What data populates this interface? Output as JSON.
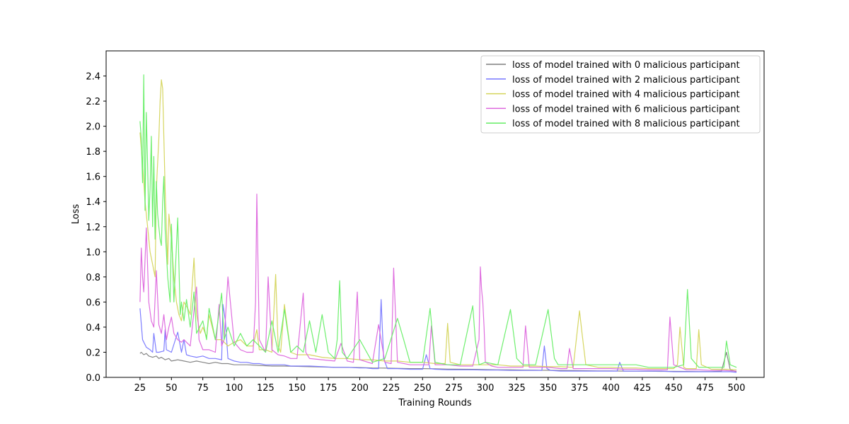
{
  "chart_data": {
    "type": "line",
    "title": "",
    "xlabel": "Training Rounds",
    "ylabel": "Loss",
    "xlim": [
      -2,
      522
    ],
    "ylim": [
      0,
      2.6
    ],
    "x_ticks": [
      25,
      50,
      75,
      100,
      125,
      150,
      175,
      200,
      225,
      250,
      275,
      300,
      325,
      350,
      375,
      400,
      425,
      450,
      475,
      500
    ],
    "y_ticks": [
      0.0,
      0.2,
      0.4,
      0.6,
      0.8,
      1.0,
      1.2,
      1.4,
      1.6,
      1.8,
      2.0,
      2.2,
      2.4
    ],
    "y_tick_labels": [
      "0.0",
      "0.2",
      "0.4",
      "0.6",
      "0.8",
      "1.0",
      "1.2",
      "1.4",
      "1.6",
      "1.8",
      "2.0",
      "2.2",
      "2.4"
    ],
    "grid": false,
    "legend_position": "top-right",
    "series": [
      {
        "name": "loss of model trained with 0 malicious participant",
        "color": "#7f7f7f",
        "x": [
          25,
          26,
          28,
          30,
          32,
          35,
          38,
          40,
          42,
          45,
          48,
          50,
          55,
          60,
          65,
          70,
          75,
          80,
          85,
          90,
          95,
          100,
          110,
          120,
          130,
          140,
          150,
          160,
          170,
          180,
          190,
          200,
          210,
          220,
          230,
          240,
          250,
          260,
          270,
          280,
          290,
          300,
          310,
          320,
          330,
          340,
          350,
          360,
          370,
          380,
          390,
          400,
          410,
          420,
          430,
          440,
          450,
          460,
          470,
          480,
          488,
          492,
          495,
          500
        ],
        "values": [
          0.19,
          0.2,
          0.18,
          0.19,
          0.17,
          0.16,
          0.17,
          0.15,
          0.16,
          0.14,
          0.15,
          0.13,
          0.14,
          0.13,
          0.12,
          0.13,
          0.12,
          0.11,
          0.12,
          0.11,
          0.11,
          0.1,
          0.1,
          0.095,
          0.09,
          0.09,
          0.088,
          0.085,
          0.083,
          0.08,
          0.08,
          0.078,
          0.075,
          0.074,
          0.072,
          0.07,
          0.07,
          0.068,
          0.066,
          0.065,
          0.064,
          0.062,
          0.06,
          0.06,
          0.058,
          0.057,
          0.056,
          0.055,
          0.054,
          0.053,
          0.052,
          0.052,
          0.05,
          0.05,
          0.049,
          0.048,
          0.048,
          0.047,
          0.046,
          0.046,
          0.05,
          0.2,
          0.06,
          0.045
        ]
      },
      {
        "name": "loss of model trained with 2 malicious participant",
        "color": "#7777ff",
        "x": [
          25,
          27,
          30,
          33,
          35,
          36,
          38,
          40,
          44,
          45,
          46,
          50,
          55,
          58,
          60,
          62,
          65,
          70,
          75,
          80,
          85,
          90,
          91,
          93,
          95,
          100,
          105,
          110,
          115,
          120,
          125,
          130,
          135,
          140,
          145,
          150,
          160,
          170,
          180,
          190,
          200,
          205,
          210,
          215,
          217,
          219,
          222,
          230,
          240,
          250,
          253,
          256,
          260,
          270,
          280,
          290,
          300,
          310,
          320,
          330,
          340,
          345,
          347,
          349,
          352,
          360,
          370,
          380,
          390,
          400,
          405,
          407,
          410,
          420,
          430,
          440,
          450,
          460,
          470,
          480,
          490,
          495,
          500
        ],
        "values": [
          0.55,
          0.3,
          0.24,
          0.22,
          0.2,
          0.35,
          0.2,
          0.2,
          0.21,
          0.38,
          0.22,
          0.2,
          0.36,
          0.2,
          0.3,
          0.18,
          0.17,
          0.16,
          0.17,
          0.15,
          0.15,
          0.14,
          0.58,
          0.45,
          0.15,
          0.13,
          0.12,
          0.12,
          0.11,
          0.11,
          0.1,
          0.1,
          0.1,
          0.1,
          0.09,
          0.09,
          0.09,
          0.085,
          0.08,
          0.08,
          0.075,
          0.075,
          0.07,
          0.07,
          0.62,
          0.15,
          0.07,
          0.07,
          0.065,
          0.065,
          0.18,
          0.07,
          0.065,
          0.06,
          0.06,
          0.06,
          0.058,
          0.058,
          0.055,
          0.055,
          0.055,
          0.055,
          0.25,
          0.07,
          0.055,
          0.05,
          0.05,
          0.05,
          0.05,
          0.05,
          0.05,
          0.12,
          0.05,
          0.05,
          0.05,
          0.05,
          0.045,
          0.045,
          0.045,
          0.045,
          0.045,
          0.045,
          0.04
        ]
      },
      {
        "name": "loss of model trained with 4 malicious participant",
        "color": "#d4d45a",
        "x": [
          25,
          27,
          29,
          31,
          33,
          35,
          37,
          38,
          40,
          41,
          42,
          43,
          45,
          47,
          48,
          50,
          52,
          54,
          56,
          58,
          60,
          63,
          65,
          68,
          70,
          73,
          75,
          78,
          80,
          85,
          90,
          95,
          100,
          105,
          110,
          115,
          118,
          120,
          125,
          130,
          133,
          135,
          137,
          140,
          145,
          150,
          160,
          170,
          180,
          190,
          200,
          210,
          220,
          230,
          240,
          250,
          260,
          268,
          270,
          272,
          280,
          290,
          300,
          310,
          320,
          330,
          340,
          350,
          360,
          370,
          375,
          377,
          380,
          390,
          400,
          410,
          420,
          430,
          440,
          450,
          453,
          455,
          458,
          460,
          468,
          470,
          472,
          480,
          490,
          500
        ],
        "values": [
          1.95,
          1.7,
          1.4,
          1.2,
          1.0,
          0.9,
          0.8,
          1.5,
          1.9,
          2.2,
          2.37,
          2.3,
          1.5,
          0.9,
          1.3,
          1.1,
          0.8,
          0.6,
          0.5,
          0.45,
          0.6,
          0.55,
          0.5,
          0.95,
          0.5,
          0.35,
          0.4,
          0.32,
          0.5,
          0.3,
          0.3,
          0.25,
          0.28,
          0.3,
          0.25,
          0.25,
          0.38,
          0.22,
          0.22,
          0.2,
          0.82,
          0.25,
          0.2,
          0.58,
          0.2,
          0.18,
          0.18,
          0.16,
          0.15,
          0.15,
          0.14,
          0.14,
          0.13,
          0.13,
          0.12,
          0.12,
          0.11,
          0.11,
          0.43,
          0.12,
          0.1,
          0.1,
          0.1,
          0.1,
          0.09,
          0.09,
          0.09,
          0.085,
          0.085,
          0.08,
          0.53,
          0.35,
          0.1,
          0.08,
          0.08,
          0.075,
          0.075,
          0.07,
          0.07,
          0.07,
          0.1,
          0.4,
          0.08,
          0.07,
          0.07,
          0.38,
          0.1,
          0.065,
          0.065,
          0.06
        ]
      },
      {
        "name": "loss of model trained with 6 malicious participant",
        "color": "#dd66dd",
        "x": [
          25,
          26,
          27,
          28,
          30,
          32,
          34,
          36,
          38,
          40,
          42,
          44,
          46,
          48,
          50,
          52,
          55,
          58,
          60,
          65,
          70,
          72,
          75,
          80,
          85,
          88,
          90,
          92,
          95,
          100,
          105,
          110,
          115,
          117,
          118,
          120,
          125,
          127,
          130,
          135,
          140,
          145,
          150,
          155,
          157,
          160,
          170,
          180,
          185,
          190,
          195,
          198,
          200,
          210,
          215,
          220,
          225,
          227,
          230,
          240,
          250,
          255,
          257,
          260,
          270,
          280,
          290,
          295,
          296,
          297,
          298,
          299,
          300,
          305,
          310,
          320,
          325,
          330,
          332,
          335,
          340,
          345,
          350,
          360,
          365,
          367,
          370,
          380,
          390,
          400,
          410,
          420,
          430,
          440,
          445,
          447,
          450,
          460,
          470,
          480,
          490,
          500
        ],
        "values": [
          0.6,
          1.03,
          0.8,
          0.68,
          1.19,
          0.6,
          0.45,
          0.4,
          0.85,
          0.42,
          0.35,
          0.5,
          0.3,
          0.4,
          0.48,
          0.35,
          0.3,
          0.28,
          0.3,
          0.25,
          0.72,
          0.3,
          0.22,
          0.22,
          0.2,
          0.58,
          0.25,
          0.3,
          0.8,
          0.28,
          0.22,
          0.2,
          0.2,
          0.6,
          1.46,
          0.3,
          0.2,
          0.8,
          0.22,
          0.18,
          0.17,
          0.15,
          0.15,
          0.67,
          0.2,
          0.15,
          0.14,
          0.13,
          0.27,
          0.13,
          0.12,
          0.68,
          0.14,
          0.11,
          0.42,
          0.12,
          0.11,
          0.87,
          0.12,
          0.1,
          0.1,
          0.1,
          0.41,
          0.1,
          0.1,
          0.09,
          0.09,
          0.3,
          0.88,
          0.7,
          0.6,
          0.4,
          0.12,
          0.09,
          0.08,
          0.08,
          0.08,
          0.08,
          0.41,
          0.08,
          0.08,
          0.08,
          0.08,
          0.07,
          0.07,
          0.23,
          0.07,
          0.07,
          0.07,
          0.07,
          0.065,
          0.065,
          0.06,
          0.06,
          0.06,
          0.48,
          0.1,
          0.06,
          0.06,
          0.055,
          0.055,
          0.05
        ]
      },
      {
        "name": "loss of model trained with 8 malicious participant",
        "color": "#66ee66",
        "x": [
          25,
          26,
          27,
          28,
          29,
          30,
          31,
          32,
          33,
          34,
          35,
          36,
          37,
          38,
          39,
          40,
          41,
          42,
          43,
          44,
          45,
          46,
          47,
          48,
          49,
          50,
          52,
          55,
          57,
          58,
          60,
          62,
          65,
          68,
          70,
          75,
          78,
          80,
          85,
          90,
          92,
          95,
          100,
          105,
          110,
          115,
          120,
          125,
          130,
          135,
          140,
          145,
          150,
          155,
          160,
          165,
          170,
          175,
          180,
          182,
          184,
          186,
          190,
          200,
          210,
          220,
          230,
          235,
          240,
          250,
          256,
          260,
          270,
          280,
          290,
          292,
          295,
          300,
          310,
          320,
          325,
          330,
          340,
          350,
          355,
          358,
          360,
          370,
          380,
          390,
          400,
          410,
          420,
          430,
          440,
          450,
          458,
          461,
          464,
          470,
          480,
          490,
          492,
          495,
          500
        ],
        "values": [
          2.04,
          1.9,
          1.55,
          2.41,
          1.33,
          2.11,
          1.7,
          1.25,
          1.5,
          1.92,
          1.2,
          1.76,
          1.1,
          1.56,
          1.3,
          1.2,
          1.1,
          1.05,
          1.4,
          1.6,
          1.18,
          1.0,
          0.8,
          0.7,
          0.6,
          1.22,
          0.6,
          1.27,
          0.5,
          0.6,
          0.45,
          0.62,
          0.4,
          0.68,
          0.35,
          0.45,
          0.3,
          0.55,
          0.3,
          0.67,
          0.3,
          0.4,
          0.25,
          0.35,
          0.25,
          0.3,
          0.25,
          0.2,
          0.45,
          0.2,
          0.54,
          0.2,
          0.25,
          0.2,
          0.45,
          0.2,
          0.5,
          0.2,
          0.15,
          0.3,
          0.77,
          0.2,
          0.15,
          0.3,
          0.12,
          0.15,
          0.47,
          0.3,
          0.12,
          0.12,
          0.55,
          0.12,
          0.1,
          0.1,
          0.57,
          0.3,
          0.1,
          0.12,
          0.1,
          0.54,
          0.15,
          0.1,
          0.1,
          0.54,
          0.15,
          0.1,
          0.1,
          0.1,
          0.1,
          0.1,
          0.1,
          0.1,
          0.1,
          0.08,
          0.08,
          0.08,
          0.1,
          0.7,
          0.15,
          0.08,
          0.08,
          0.08,
          0.29,
          0.1,
          0.08
        ]
      }
    ]
  }
}
